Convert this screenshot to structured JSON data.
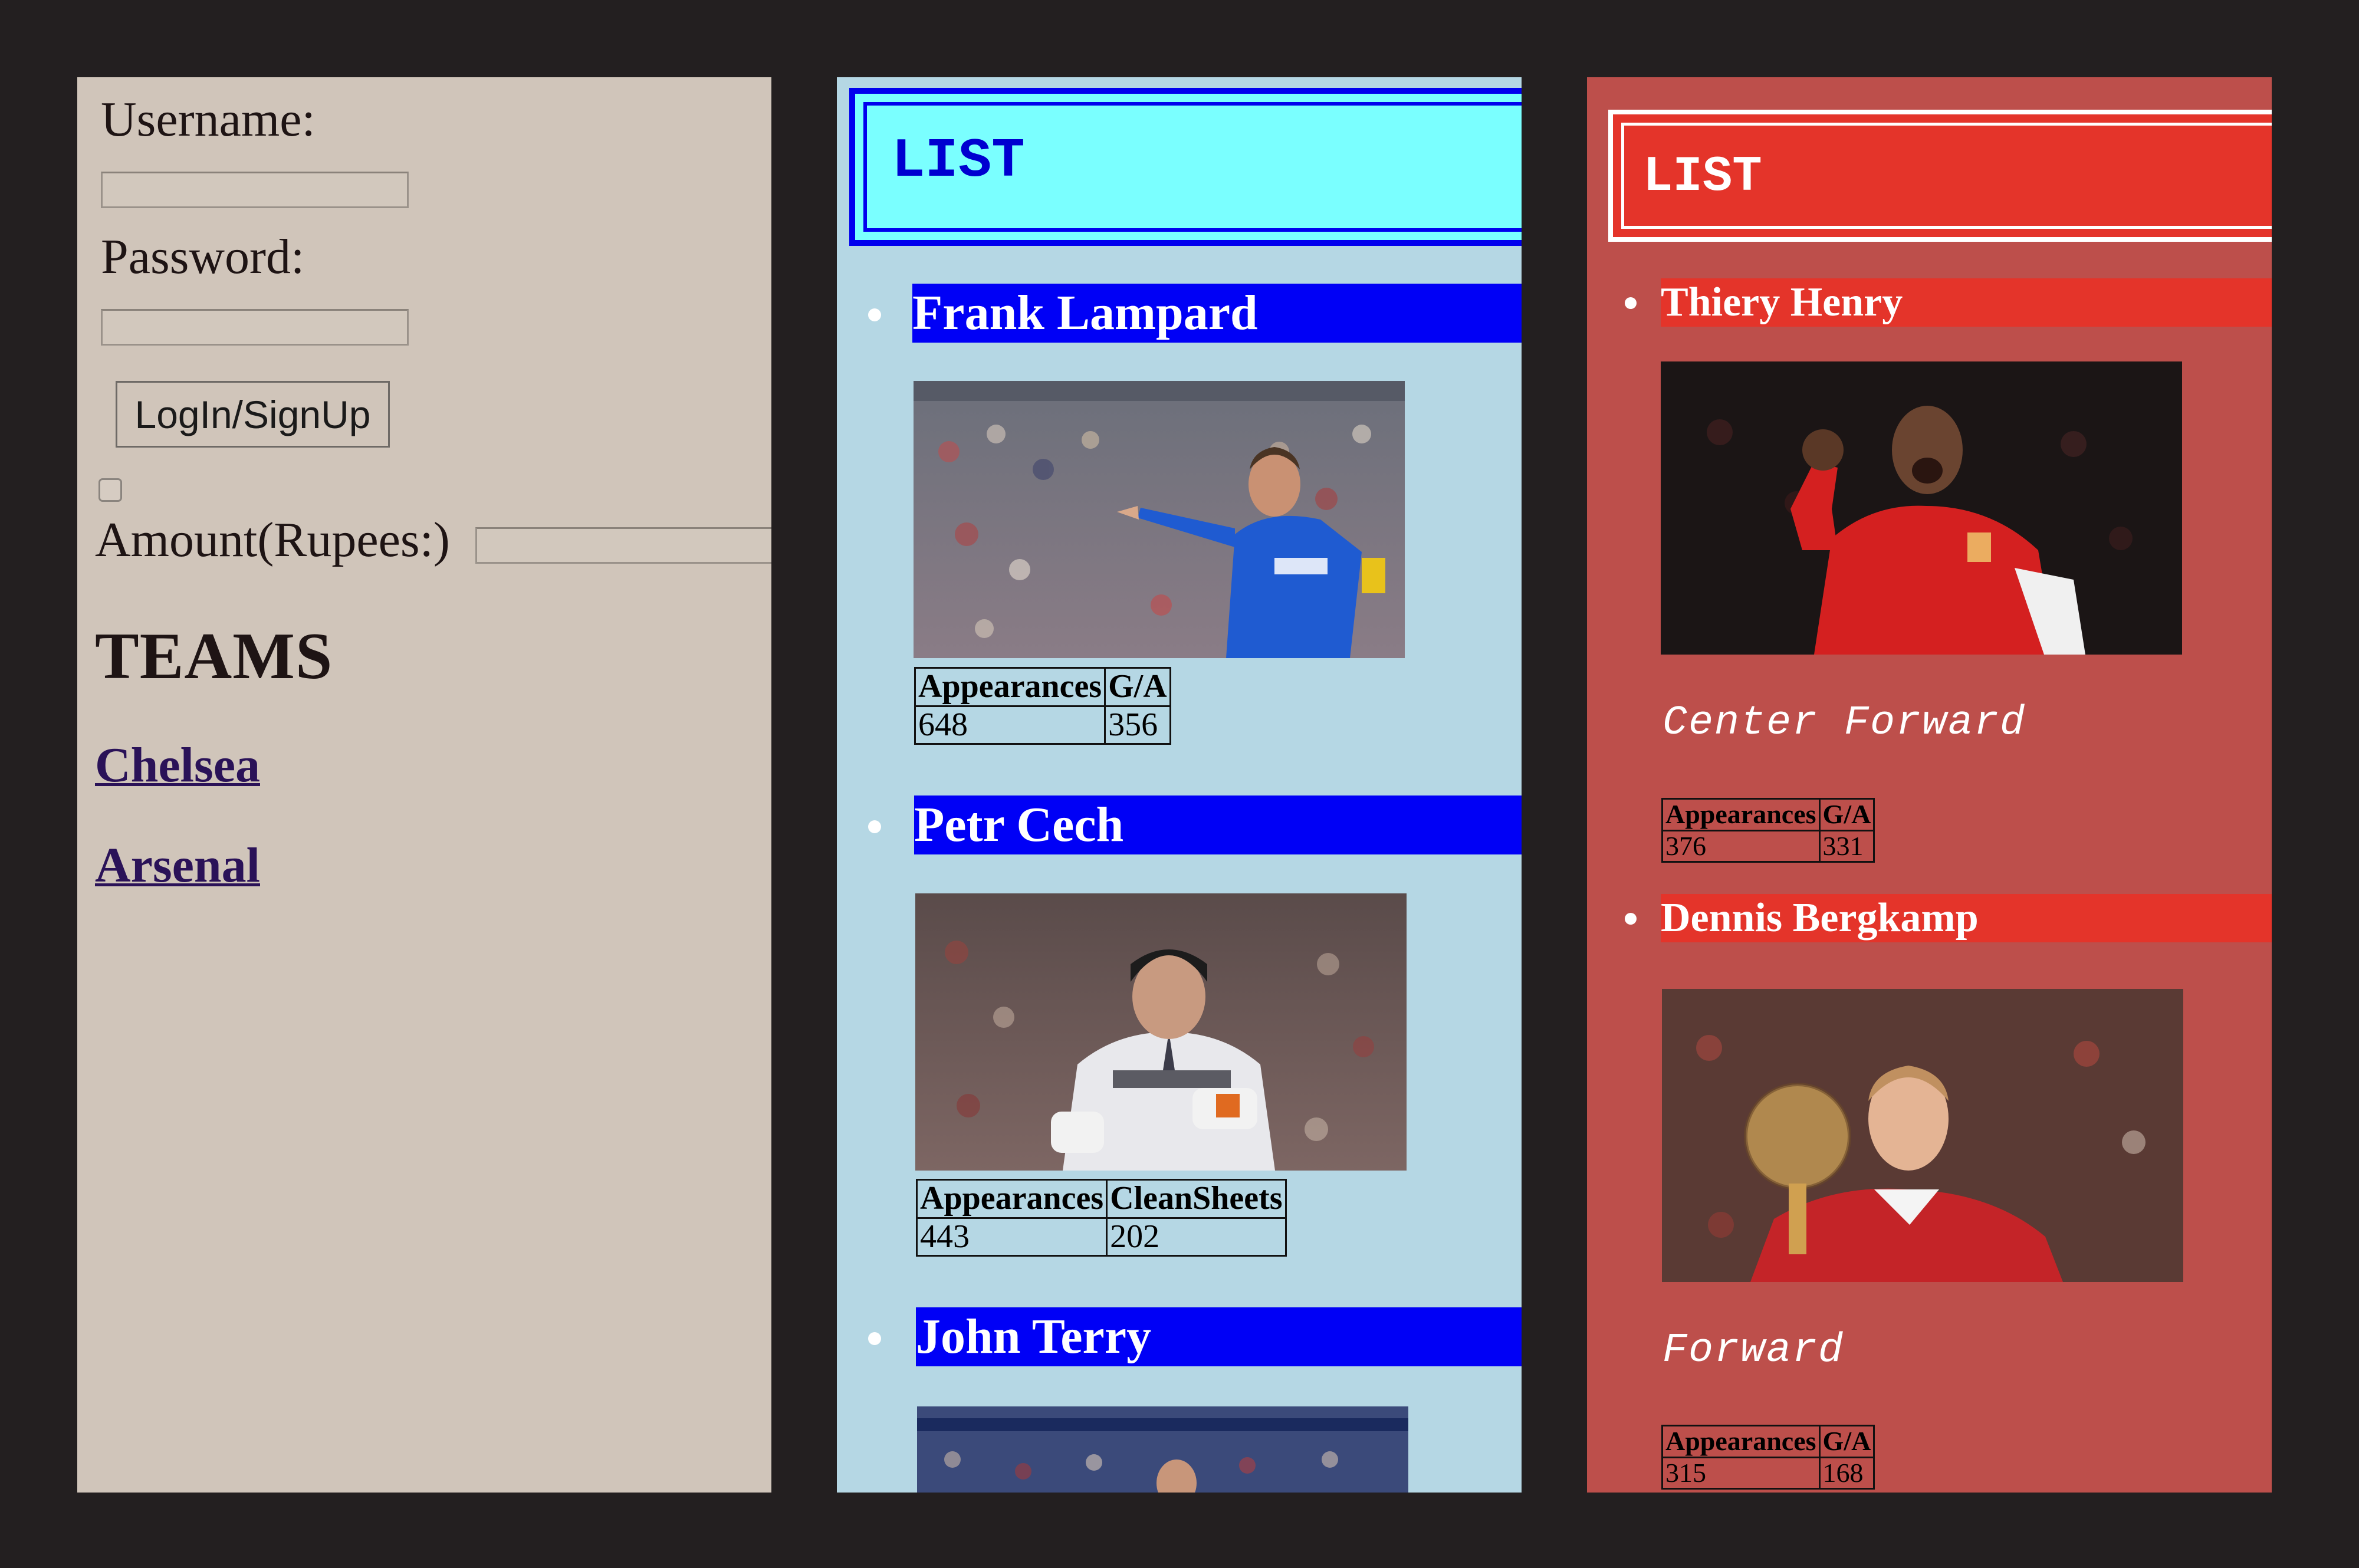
{
  "login": {
    "username_label": "Username:",
    "username_value": "",
    "password_label": "Password:",
    "password_value": "",
    "button_label": "LogIn/SignUp",
    "amount_label": "Amount(Rupees:)",
    "amount_value": ""
  },
  "teams": {
    "title": "TEAMS",
    "links": [
      "Chelsea",
      "Arsenal"
    ]
  },
  "chelsea": {
    "header": "LIST",
    "players": [
      {
        "name": "Frank Lampard",
        "stats_headers": [
          "Appearances",
          "G/A"
        ],
        "stats_values": [
          "648",
          "356"
        ]
      },
      {
        "name": "Petr Cech",
        "stats_headers": [
          "Appearances",
          "CleanSheets"
        ],
        "stats_values": [
          "443",
          "202"
        ]
      },
      {
        "name": "John Terry"
      }
    ]
  },
  "arsenal": {
    "header": "LIST",
    "players": [
      {
        "name": "Thiery Henry",
        "position": "Center Forward",
        "stats_headers": [
          "Appearances",
          "G/A"
        ],
        "stats_values": [
          "376",
          "331"
        ]
      },
      {
        "name": "Dennis Bergkamp",
        "position": "Forward",
        "stats_headers": [
          "Appearances",
          "G/A"
        ],
        "stats_values": [
          "315",
          "168"
        ]
      }
    ]
  },
  "colors": {
    "login_bg": "#d0c5ba",
    "chelsea_bg": "#b5d7e4",
    "chelsea_header": "#7affff",
    "chelsea_bar": "#0000f6",
    "arsenal_bg": "#bd4f4b",
    "arsenal_header": "#e4342a",
    "page_bg": "#231f20"
  }
}
